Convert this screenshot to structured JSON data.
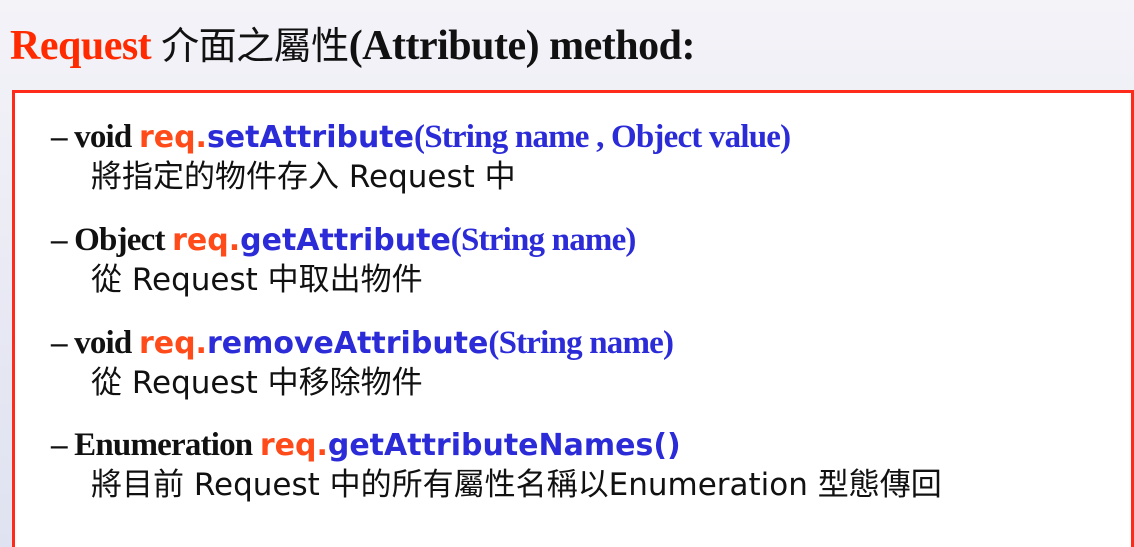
{
  "slide": {
    "title": {
      "accent": "Request",
      "zh": "介面之屬性",
      "rest": "(Attribute) method:"
    },
    "items": [
      {
        "dash_type": "– void",
        "obj": "req.",
        "method": "setAttribute",
        "params": "(String name , Object value)",
        "description": "將指定的物件存入 Request 中"
      },
      {
        "dash_type": "– Object",
        "obj": "req.",
        "method": "getAttribute",
        "params": "(String name)",
        "description": "從 Request 中取出物件"
      },
      {
        "dash_type": "– void",
        "obj": "req.",
        "method": "removeAttribute",
        "params": "(String name)",
        "description": "從 Request 中移除物件"
      },
      {
        "dash_type": "– Enumeration",
        "obj": "req.",
        "method": "getAttributeNames()",
        "params": "",
        "description": "將目前 Request 中的所有屬性名稱以Enumeration 型態傳回"
      }
    ],
    "colors": {
      "accent": "#ff2a00",
      "method": "#2b2bd8",
      "border": "#ff2a1a"
    }
  }
}
